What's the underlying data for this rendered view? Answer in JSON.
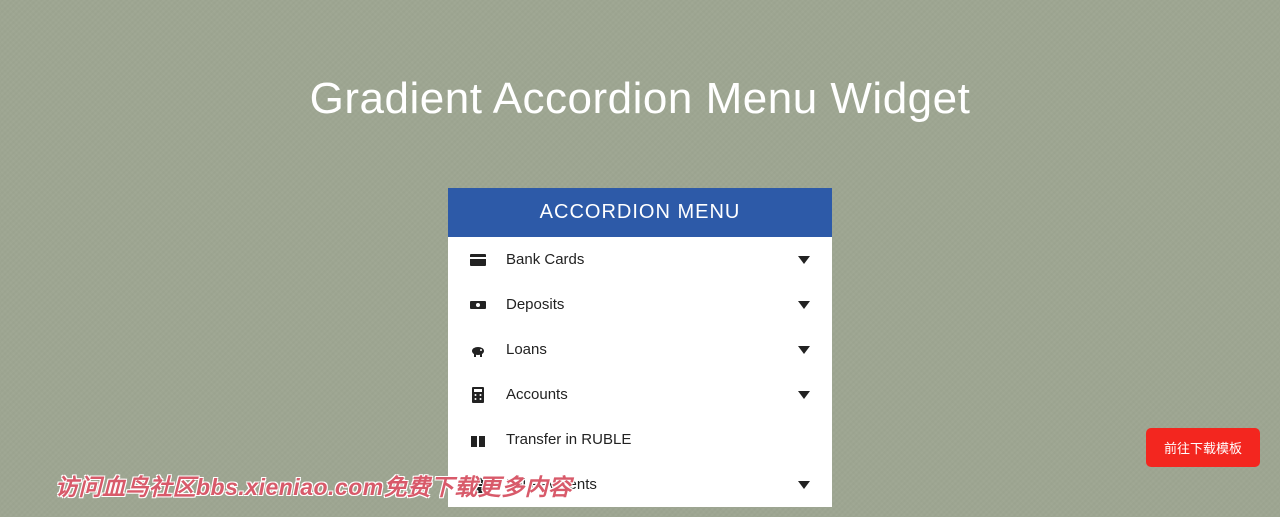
{
  "page": {
    "title": "Gradient Accordion Menu Widget"
  },
  "accordion": {
    "header": "ACCORDION MENU",
    "items": [
      {
        "label": "Bank Cards",
        "icon": "card-icon",
        "expandable": true
      },
      {
        "label": "Deposits",
        "icon": "money-icon",
        "expandable": true
      },
      {
        "label": "Loans",
        "icon": "piggy-icon",
        "expandable": true
      },
      {
        "label": "Accounts",
        "icon": "calculator-icon",
        "expandable": true
      },
      {
        "label": "Transfer in RUBLE",
        "icon": "gift-icon",
        "expandable": false
      },
      {
        "label": "Bill Payments",
        "icon": "file-icon",
        "expandable": true
      }
    ]
  },
  "action_button": {
    "label": "前往下载模板"
  },
  "watermark": {
    "text": "访问血鸟社区bbs.xieniao.com免费下载更多内容"
  },
  "colors": {
    "background": "#9ea692",
    "header_bg": "#2d5aa8",
    "panel_bg": "#ffffff",
    "action_bg": "#f3261f",
    "title_color": "#ffffff"
  }
}
